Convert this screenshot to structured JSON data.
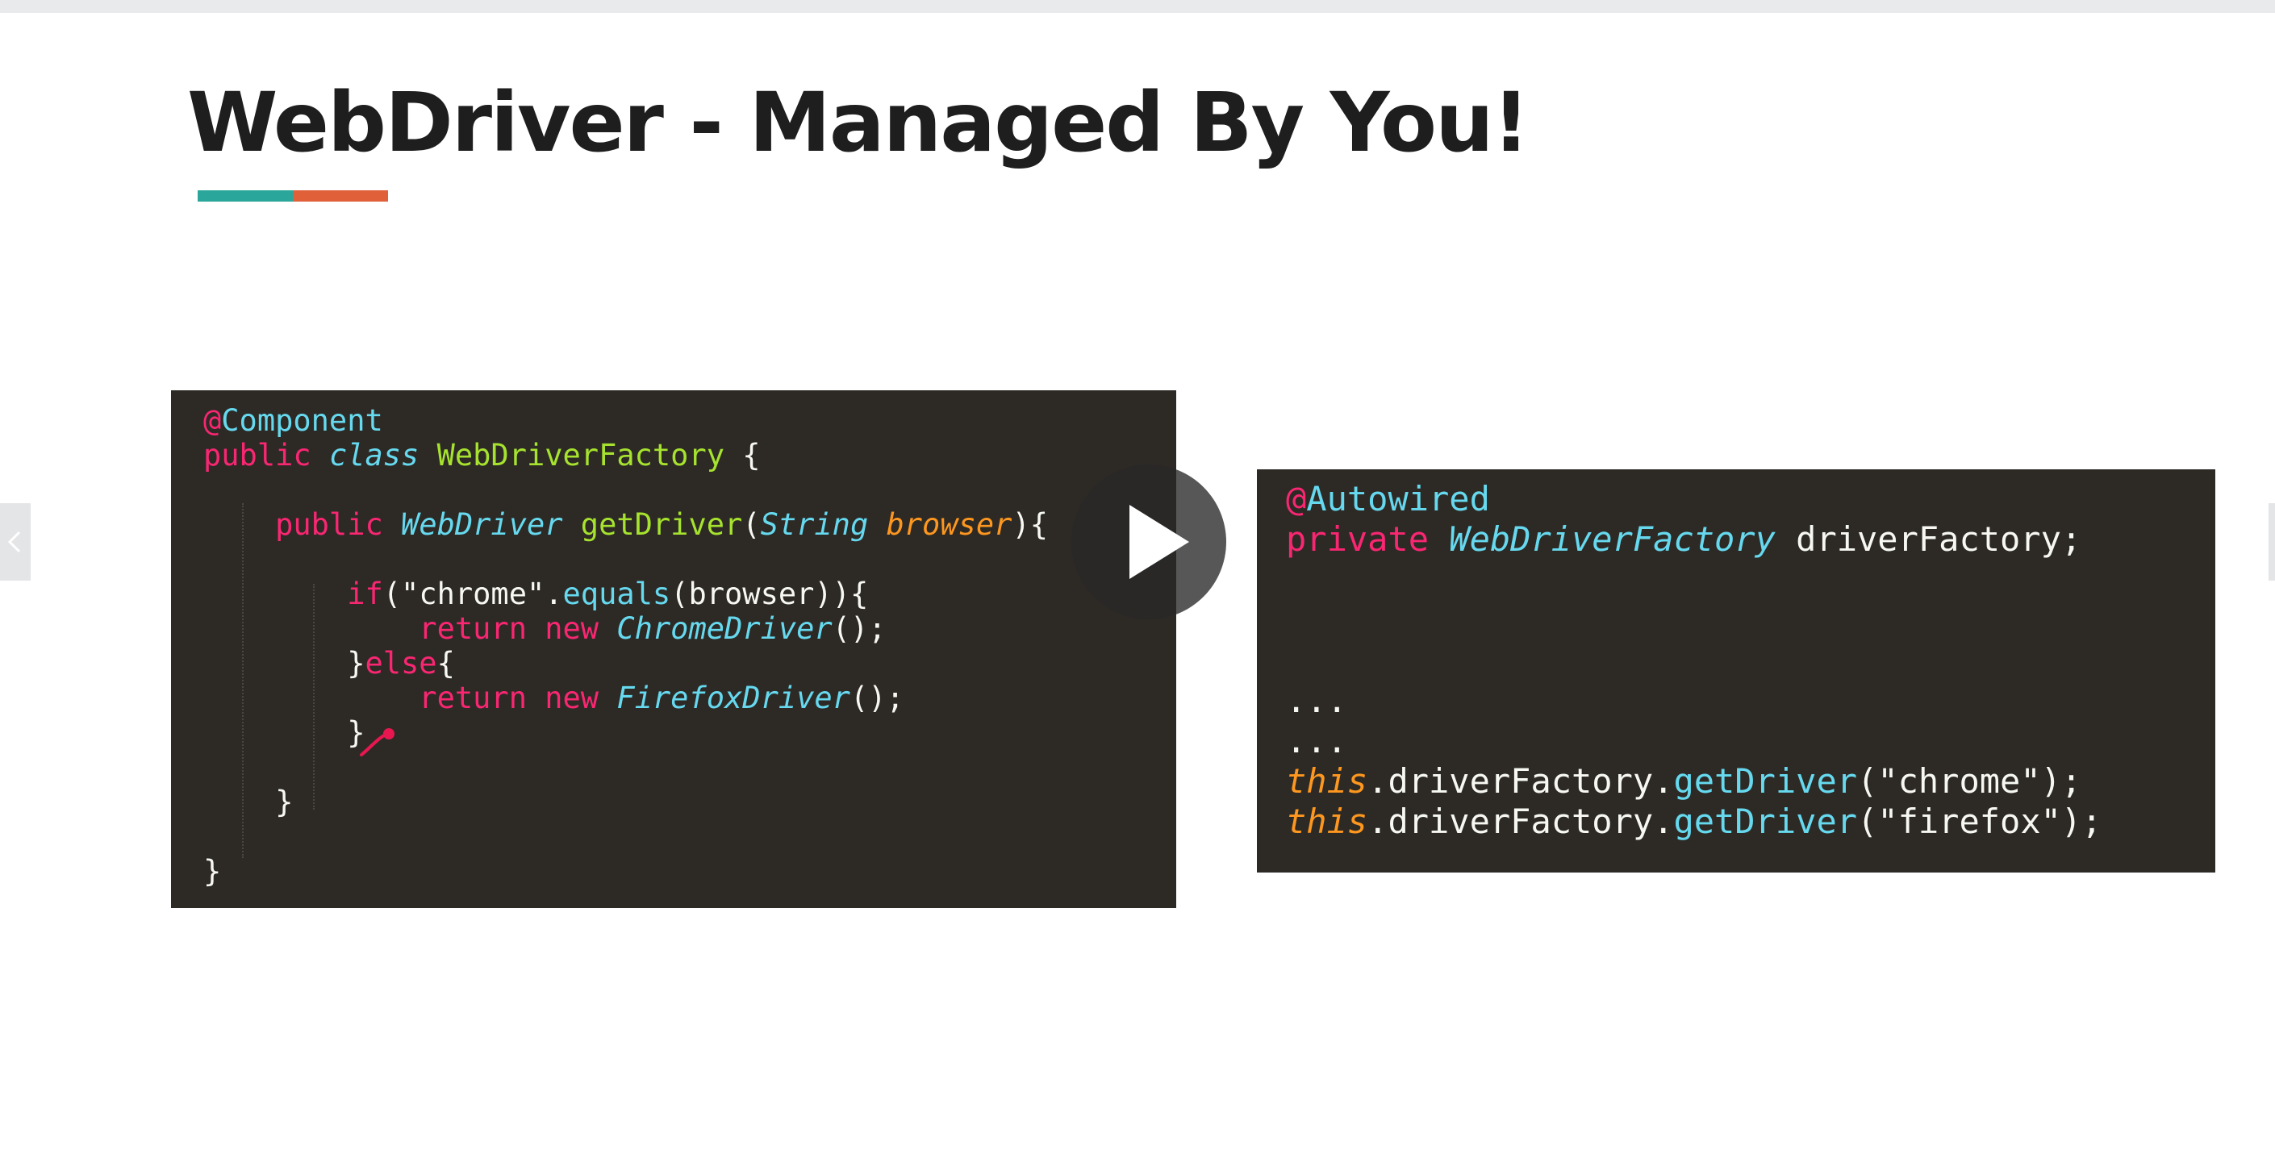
{
  "slide": {
    "title": "WebDriver - Managed By You!",
    "underline_colors": [
      "#2aa69a",
      "#e0603a"
    ]
  },
  "code_left": {
    "lines": [
      [
        {
          "t": "@",
          "c": "pink"
        },
        {
          "t": "Component",
          "c": "cyan"
        }
      ],
      [
        {
          "t": "public ",
          "c": "pink"
        },
        {
          "t": "class ",
          "c": "cyan-i"
        },
        {
          "t": "WebDriverFactory",
          "c": "green"
        },
        {
          "t": " {",
          "c": "white"
        }
      ],
      [],
      [
        {
          "t": "    public ",
          "c": "pink"
        },
        {
          "t": "WebDriver",
          "c": "cyan-i"
        },
        {
          "t": " getDriver",
          "c": "green"
        },
        {
          "t": "(",
          "c": "white"
        },
        {
          "t": "String",
          "c": "cyan-i"
        },
        {
          "t": " browser",
          "c": "orange-i"
        },
        {
          "t": "){",
          "c": "white"
        }
      ],
      [],
      [
        {
          "t": "        if",
          "c": "pink"
        },
        {
          "t": "(\"chrome\".",
          "c": "white"
        },
        {
          "t": "equals",
          "c": "cyan"
        },
        {
          "t": "(browser)){",
          "c": "white"
        }
      ],
      [
        {
          "t": "            return new ",
          "c": "pink"
        },
        {
          "t": "ChromeDriver",
          "c": "cyan-i"
        },
        {
          "t": "();",
          "c": "white"
        }
      ],
      [
        {
          "t": "        }",
          "c": "white"
        },
        {
          "t": "else",
          "c": "pink"
        },
        {
          "t": "{",
          "c": "white"
        }
      ],
      [
        {
          "t": "            return new ",
          "c": "pink"
        },
        {
          "t": "FirefoxDriver",
          "c": "cyan-i"
        },
        {
          "t": "();",
          "c": "white"
        }
      ],
      [
        {
          "t": "        }",
          "c": "white"
        }
      ],
      [],
      [
        {
          "t": "    }",
          "c": "white"
        }
      ],
      [],
      [
        {
          "t": "}",
          "c": "white"
        }
      ]
    ]
  },
  "code_right": {
    "lines": [
      [
        {
          "t": "@",
          "c": "pink"
        },
        {
          "t": "Autowired",
          "c": "cyan"
        }
      ],
      [
        {
          "t": "private ",
          "c": "pink"
        },
        {
          "t": "WebDriverFactory",
          "c": "cyan-i"
        },
        {
          "t": " driverFactory;",
          "c": "white"
        }
      ],
      [],
      [],
      [],
      [
        {
          "t": "...",
          "c": "white"
        }
      ],
      [
        {
          "t": "...",
          "c": "white"
        }
      ],
      [
        {
          "t": "this",
          "c": "orange-i"
        },
        {
          "t": ".driverFactory.",
          "c": "white"
        },
        {
          "t": "getDriver",
          "c": "cyan"
        },
        {
          "t": "(\"chrome\");",
          "c": "white"
        }
      ],
      [
        {
          "t": "this",
          "c": "orange-i"
        },
        {
          "t": ".driverFactory.",
          "c": "white"
        },
        {
          "t": "getDriver",
          "c": "cyan"
        },
        {
          "t": "(\"firefox\");",
          "c": "white"
        }
      ]
    ]
  },
  "video": {
    "play_icon": "play-icon"
  },
  "nav": {
    "prev_icon": "chevron-left-icon",
    "next_icon": "chevron-right-icon"
  }
}
